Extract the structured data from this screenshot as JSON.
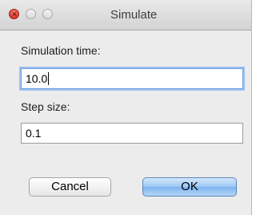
{
  "window": {
    "title": "Simulate"
  },
  "form": {
    "simulation_time": {
      "label": "Simulation time:",
      "value": "10.0"
    },
    "step_size": {
      "label": "Step size:",
      "value": "0.1"
    }
  },
  "buttons": {
    "cancel_label": "Cancel",
    "ok_label": "OK"
  }
}
